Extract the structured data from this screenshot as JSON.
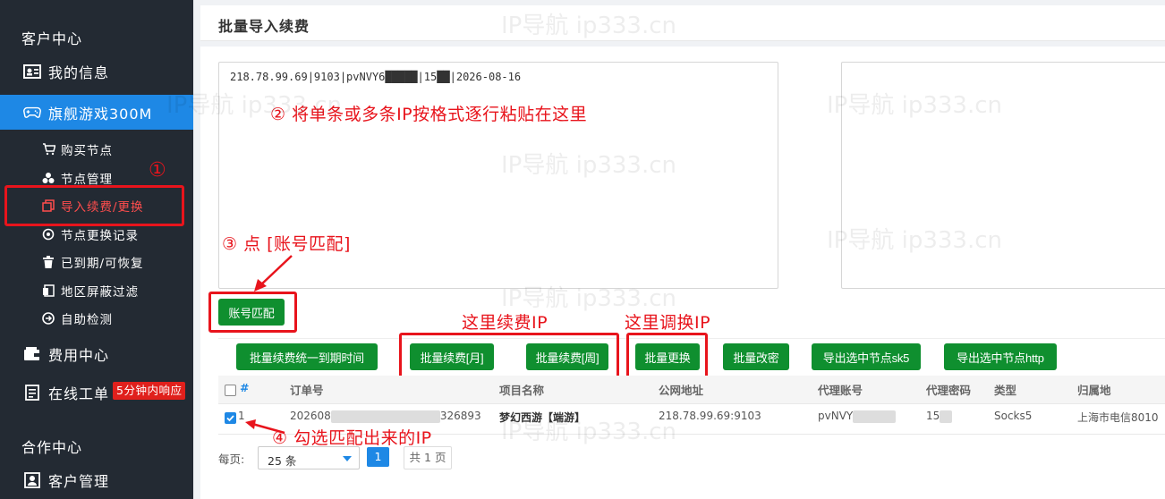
{
  "sidebar": {
    "customer_center": "客户中心",
    "my_info": "我的信息",
    "flagship_game": "旗舰游戏300M",
    "buy_nodes": "购买节点",
    "node_manage": "节点管理",
    "import_renew": "导入续费/更换",
    "node_change_log": "节点更换记录",
    "expired_recoverable": "已到期/可恢复",
    "region_block_filter": "地区屏蔽过滤",
    "self_check": "自助检测",
    "fee_center": "费用中心",
    "online_ticket": "在线工单",
    "ticket_badge": "5分钟内响应",
    "partner_center": "合作中心",
    "customer_manage": "客户管理"
  },
  "page": {
    "title": "批量导入续费",
    "textarea_value": "218.78.99.69|9103|pvNVY6█████|15██|2026-08-16",
    "match_button": "账号匹配"
  },
  "buttons": {
    "renew_unify": "批量续费统一到期时间",
    "renew_month": "批量续费[月]",
    "renew_week": "批量续费[周]",
    "batch_change": "批量更换",
    "batch_pwd": "批量改密",
    "export_sk5": "导出选中节点sk5",
    "export_http": "导出选中节点http"
  },
  "annotations": {
    "a1": "①",
    "a2": "② 将单条或多条IP按格式逐行粘贴在这里",
    "a3": "③ 点 [账号匹配]",
    "a4": "④ 勾选匹配出来的IP",
    "renew_here": "这里续费IP",
    "change_here": "这里调换IP"
  },
  "table": {
    "headers": {
      "hash": "#",
      "order": "订单号",
      "project": "项目名称",
      "ip": "公网地址",
      "account": "代理账号",
      "password": "代理密码",
      "type": "类型",
      "location": "归属地"
    },
    "row": {
      "index": "1",
      "order_prefix": "202608",
      "order_suffix": "326893",
      "project": "梦幻西游【端游】",
      "ip": "218.78.99.69:9103",
      "account": "pvNVY",
      "password": "15",
      "type": "Socks5",
      "location": "上海市电信8010"
    }
  },
  "pagination": {
    "per_page_label": "每页:",
    "per_page_value": "25 条",
    "current_page": "1",
    "total": "共 1 页"
  },
  "watermark": "IP导航  ip333.cn",
  "colors": {
    "sidebar_bg": "#232a33",
    "active_blue": "#1e88e5",
    "btn_green": "#0f8f2f",
    "anno_red": "#e8141c"
  }
}
